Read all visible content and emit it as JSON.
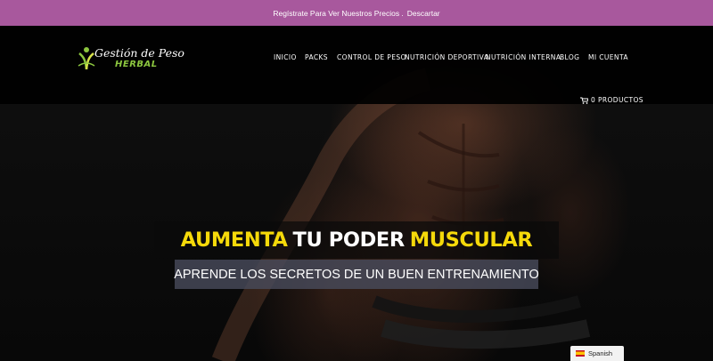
{
  "notice": {
    "text": "Regístrate Para Ver Nuestros Precios .",
    "dismiss": "Descartar"
  },
  "brand": {
    "script": "Gestión de Peso",
    "herbal": "HERBAL"
  },
  "nav": {
    "items": [
      {
        "label": "INICIO"
      },
      {
        "label": "PACKS"
      },
      {
        "label": "CONTROL DE PESO"
      },
      {
        "label": "NUTRICIÓN DEPORTIVA"
      },
      {
        "label": "NUTRICIÓN INTERNA"
      },
      {
        "label": "BLOG"
      },
      {
        "label": "MI CUENTA"
      }
    ]
  },
  "cart": {
    "icon": "cart-icon",
    "label": "0 PRODUCTOS"
  },
  "hero": {
    "headline_1": "AUMENTA",
    "headline_2": "TU PODER",
    "headline_3": "MUSCULAR",
    "subheadline": "APRENDE LOS SECRETOS DE UN BUEN ENTRENAMIENTO"
  },
  "language": {
    "label": "Spanish",
    "flag": "spain-flag-icon"
  },
  "colors": {
    "notice_bar": "#a8589d",
    "accent_yellow": "#f5d90a",
    "brand_green": "#8cc63f",
    "header_bg": "#000000"
  }
}
